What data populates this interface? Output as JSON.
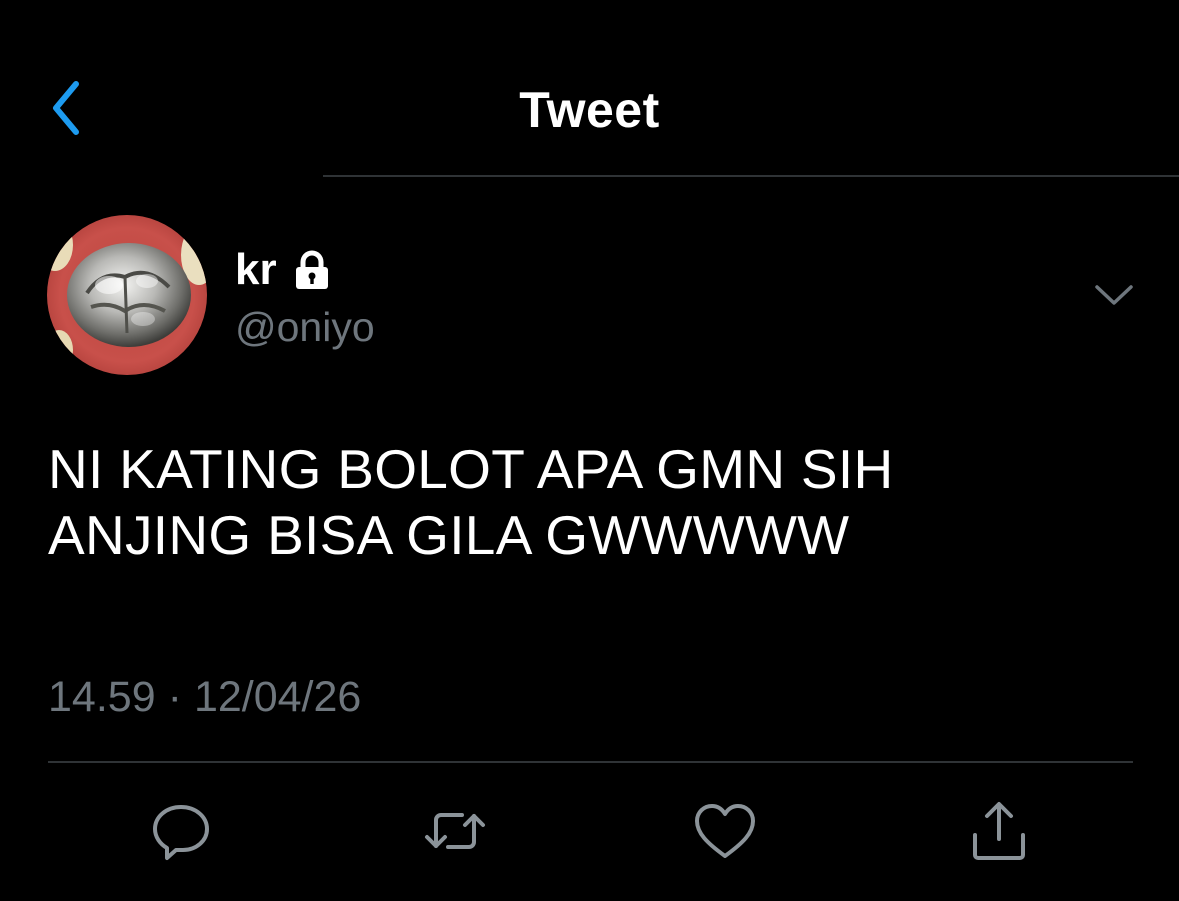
{
  "header": {
    "title": "Tweet",
    "back_icon": "chevron-left-icon"
  },
  "author": {
    "name": "kr",
    "handle": "@oniyo",
    "protected_icon": "lock-icon",
    "avatar": "tooth-crown-photo"
  },
  "tweet": {
    "lines": [
      "NI KATING BOLOT APA GMN SIH",
      "ANJING BISA GILA GWWWWW"
    ],
    "time": "14.59",
    "separator": "·",
    "date": "12/04/26"
  },
  "actions": {
    "icons": [
      "reply-icon",
      "retweet-icon",
      "like-icon",
      "share-icon"
    ]
  },
  "colors": {
    "background": "#000000",
    "text": "#ffffff",
    "secondary_text": "#6e767d",
    "accent": "#1d9bf0",
    "divider": "#2f3336"
  }
}
